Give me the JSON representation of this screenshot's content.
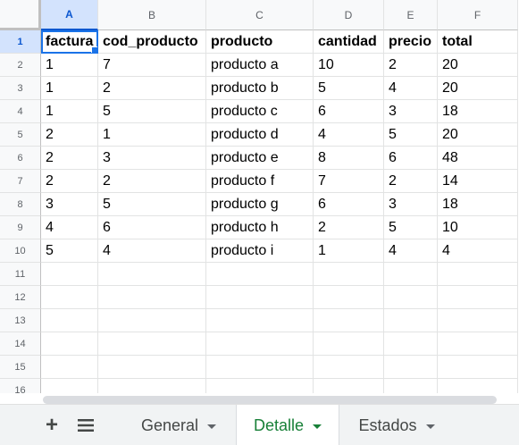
{
  "columns": [
    "A",
    "B",
    "C",
    "D",
    "E",
    "F"
  ],
  "rows": [
    "1",
    "2",
    "3",
    "4",
    "5",
    "6",
    "7",
    "8",
    "9",
    "10",
    "11",
    "12",
    "13",
    "14",
    "15",
    "16"
  ],
  "selected_cell": "A1",
  "cells": [
    [
      "factura",
      "cod_producto",
      "producto",
      "cantidad",
      "precio",
      "total"
    ],
    [
      "1",
      "7",
      "producto a",
      "10",
      "2",
      "20"
    ],
    [
      "1",
      "2",
      "producto b",
      "5",
      "4",
      "20"
    ],
    [
      "1",
      "5",
      "producto c",
      "6",
      "3",
      "18"
    ],
    [
      "2",
      "1",
      "producto d",
      "4",
      "5",
      "20"
    ],
    [
      "2",
      "3",
      "producto e",
      "8",
      "6",
      "48"
    ],
    [
      "2",
      "2",
      "producto f",
      "7",
      "2",
      "14"
    ],
    [
      "3",
      "5",
      "producto g",
      "6",
      "3",
      "18"
    ],
    [
      "4",
      "6",
      "producto h",
      "2",
      "5",
      "10"
    ],
    [
      "5",
      "4",
      "producto i",
      "1",
      "4",
      "4"
    ],
    [
      "",
      "",
      "",
      "",
      "",
      ""
    ],
    [
      "",
      "",
      "",
      "",
      "",
      ""
    ],
    [
      "",
      "",
      "",
      "",
      "",
      ""
    ],
    [
      "",
      "",
      "",
      "",
      "",
      ""
    ],
    [
      "",
      "",
      "",
      "",
      "",
      ""
    ],
    [
      "",
      "",
      "",
      "",
      "",
      ""
    ]
  ],
  "sheet_tabs": [
    {
      "label": "General",
      "active": false
    },
    {
      "label": "Detalle",
      "active": true
    },
    {
      "label": "Estados",
      "active": false
    }
  ],
  "icons": {
    "add_sheet": "plus-icon",
    "all_sheets": "hamburger-menu-icon"
  },
  "colors": {
    "accent": "#1a73e8",
    "active_tab": "#188038",
    "header_bg": "#f8f9fa",
    "gridline": "#e2e3e3"
  }
}
